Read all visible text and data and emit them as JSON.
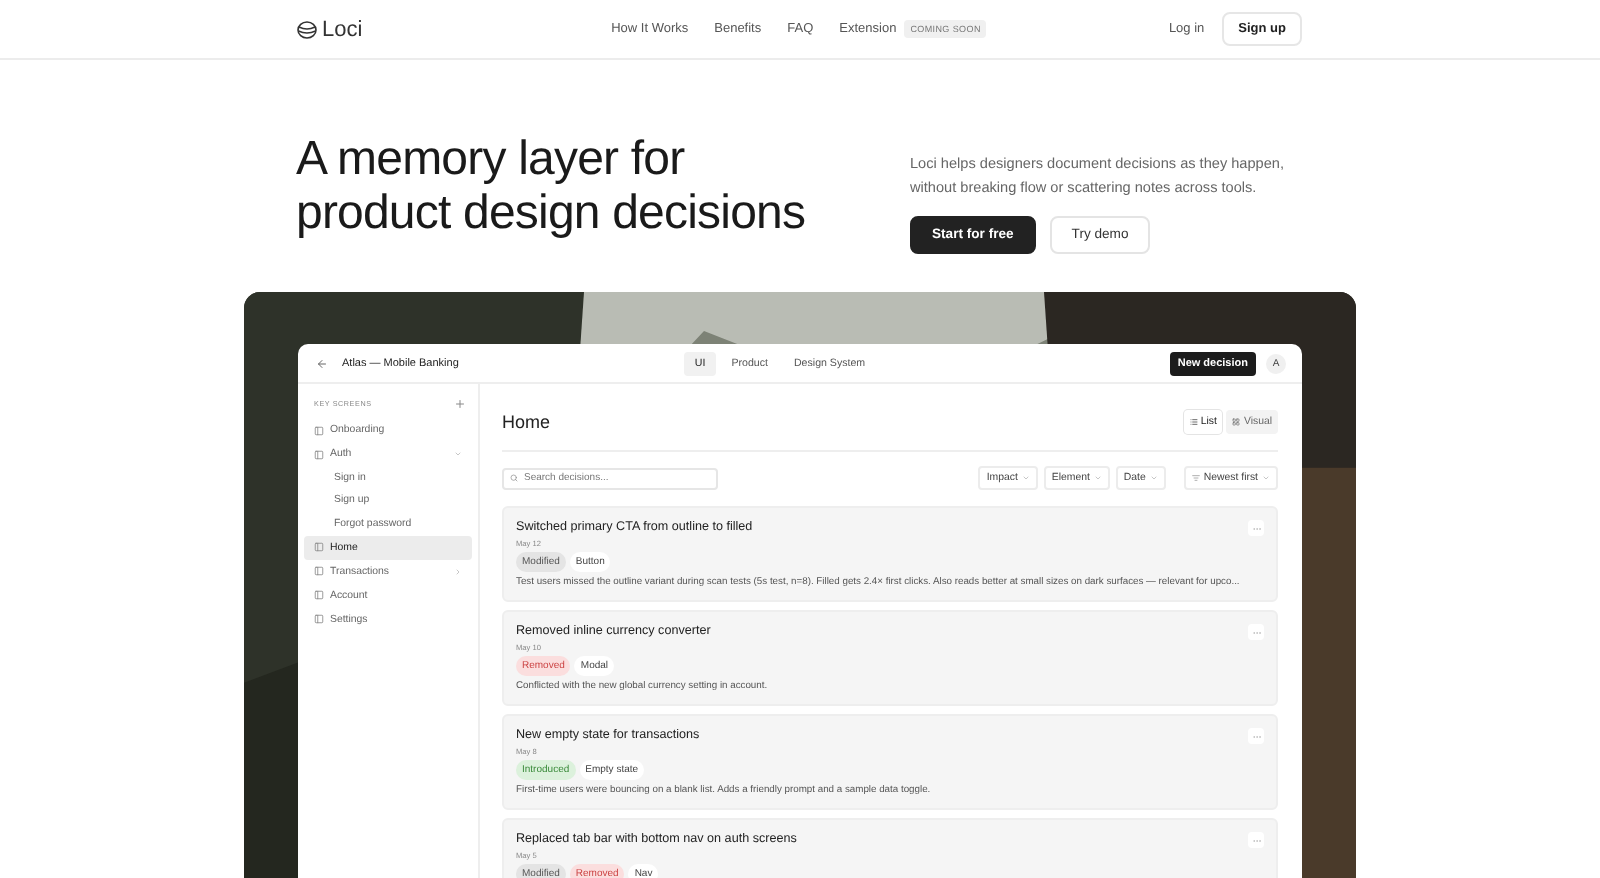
{
  "nav": {
    "logo": "Loci",
    "links": [
      {
        "label": "How It Works"
      },
      {
        "label": "Benefits"
      },
      {
        "label": "FAQ"
      },
      {
        "label": "Extension",
        "badge": "COMING SOON"
      }
    ],
    "login": "Log in",
    "signup": "Sign up"
  },
  "hero": {
    "heading_lines": [
      "A memory layer for",
      "product design decisions"
    ],
    "description": "Loci helps designers document decisions as they happen, without breaking flow or scattering notes across tools.",
    "buttons": [
      {
        "label": "Start for free",
        "kind": "primary"
      },
      {
        "label": "Try demo",
        "kind": "secondary"
      }
    ]
  },
  "app": {
    "project": "Atlas — Mobile Banking",
    "tabs": [
      {
        "label": "UI",
        "selected": true
      },
      {
        "label": "Product",
        "selected": false
      },
      {
        "label": "Design System",
        "selected": false
      }
    ],
    "new_button": "New decision",
    "avatar": "A",
    "sidebar": {
      "section": "KEY SCREENS",
      "items": [
        {
          "label": "Onboarding",
          "selected": false
        },
        {
          "label": "Auth",
          "selected": false,
          "expanded": true,
          "children": [
            {
              "label": "Sign in"
            },
            {
              "label": "Sign up"
            },
            {
              "label": "Forgot password"
            }
          ]
        },
        {
          "label": "Home",
          "selected": true
        },
        {
          "label": "Transactions",
          "selected": false,
          "expanded": false
        },
        {
          "label": "Account",
          "selected": false
        },
        {
          "label": "Settings",
          "selected": false
        }
      ]
    },
    "page_title": "Home",
    "views": [
      {
        "label": "List",
        "kind": "list",
        "selected": true
      },
      {
        "label": "Visual",
        "kind": "visual",
        "selected": false
      }
    ],
    "search": {
      "placeholder": "Search decisions..."
    },
    "filters": [
      {
        "label": "Impact",
        "kind": "dropdown"
      },
      {
        "label": "Element",
        "kind": "dropdown"
      },
      {
        "label": "Date",
        "kind": "dropdown"
      },
      {
        "label": "Newest first",
        "kind": "sort"
      }
    ],
    "cards": [
      {
        "title": "Switched primary CTA from outline to filled",
        "date": "May 12",
        "tags": [
          {
            "label": "Modified",
            "kind": "modified"
          },
          {
            "label": "Button",
            "kind": "element"
          }
        ],
        "description": "Test users missed the outline variant during scan tests (5s test, n=8). Filled gets 2.4× first clicks. Also reads better at small sizes on dark surfaces — relevant for upco..."
      },
      {
        "title": "Removed inline currency converter",
        "date": "May 10",
        "tags": [
          {
            "label": "Removed",
            "kind": "removed"
          },
          {
            "label": "Modal",
            "kind": "element"
          }
        ],
        "description": "Conflicted with the new global currency setting in account."
      },
      {
        "title": "New empty state for transactions",
        "date": "May 8",
        "tags": [
          {
            "label": "Introduced",
            "kind": "introduced"
          },
          {
            "label": "Empty state",
            "kind": "element"
          }
        ],
        "description": "First-time users were bouncing on a blank list. Adds a friendly prompt and a sample data toggle."
      },
      {
        "title": "Replaced tab bar with bottom nav on auth screens",
        "date": "May 5",
        "tags": [
          {
            "label": "Modified",
            "kind": "modified"
          },
          {
            "label": "Removed",
            "kind": "removed"
          },
          {
            "label": "Nav",
            "kind": "element"
          }
        ]
      }
    ]
  }
}
